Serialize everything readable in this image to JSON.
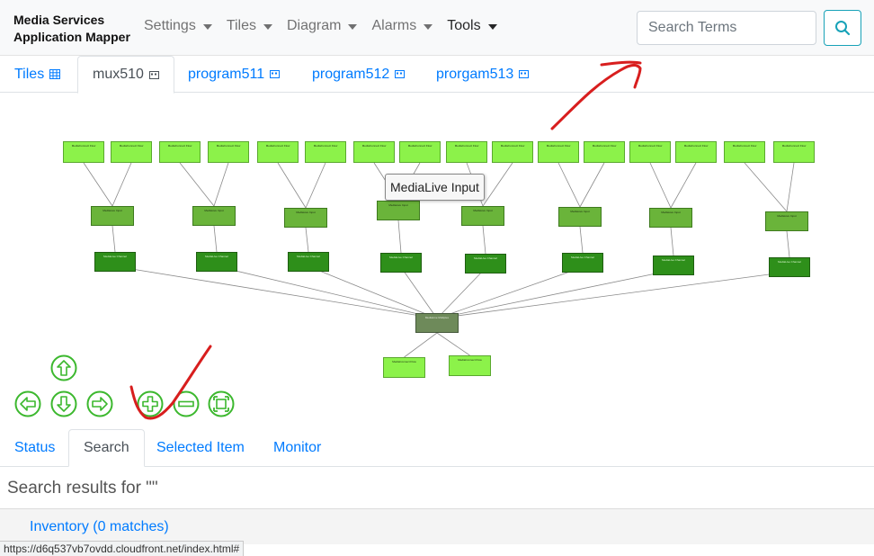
{
  "brand": {
    "line1": "Media Services",
    "line2": "Application Mapper"
  },
  "nav": [
    {
      "label": "Settings"
    },
    {
      "label": "Tiles"
    },
    {
      "label": "Diagram"
    },
    {
      "label": "Alarms"
    },
    {
      "label": "Tools"
    }
  ],
  "search": {
    "placeholder": "Search Terms",
    "value": ""
  },
  "top_tabs": [
    {
      "label": "Tiles"
    },
    {
      "label": "mux510"
    },
    {
      "label": "program511"
    },
    {
      "label": "program512"
    },
    {
      "label": "prorgam513"
    }
  ],
  "diagram": {
    "tooltip": "MediaLive Input",
    "node_labels": {
      "flow": "MediaConnect Flow",
      "input": "MediaLive Input",
      "channel": "MediaLive Channel",
      "mux": "MediaLive Multiplex"
    }
  },
  "bottom_tabs": [
    {
      "label": "Status"
    },
    {
      "label": "Search"
    },
    {
      "label": "Selected Item"
    },
    {
      "label": "Monitor"
    }
  ],
  "search_results": {
    "title": "Search results for \"\"",
    "inventory_link": "Inventory (0 matches)"
  },
  "status_bar": {
    "url": "https://d6q537vb7ovdd.cloudfront.net/index.html#"
  },
  "colors": {
    "link": "#007bff",
    "info": "#17a2b8",
    "flow_node": "#8cf24a",
    "input_node": "#6ab43a",
    "channel_node": "#2e8f1a",
    "mux_node": "#6e8a5a",
    "control": "#3cb82e",
    "annotation": "#d81e1e"
  }
}
